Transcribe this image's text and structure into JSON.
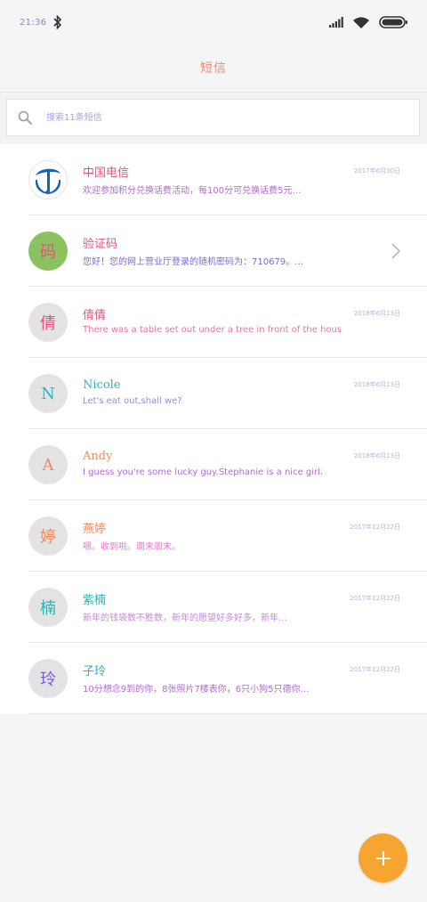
{
  "status_bar": {
    "time": "21:36"
  },
  "header": {
    "title": "短信"
  },
  "search": {
    "placeholder": "搜索11条短信"
  },
  "colors": {
    "fab": "#f6a531",
    "avatar_bg": "#e3e3e3",
    "divider": "#e6e6e6"
  },
  "messages": [
    {
      "avatar": "telecom-logo",
      "avatar_text": "",
      "name": "中国电信",
      "date": "2017年6月30日",
      "preview": "欢迎参加积分兑换话费活动，每100分可兑换话费5元…",
      "name_color": "#e8517f",
      "preview_color": "#b06ad6"
    },
    {
      "avatar": "",
      "avatar_text": "码",
      "name": "验证码",
      "date": "",
      "preview": "您好！您的网上营业厅登录的随机密码为：710679。…",
      "name_color": "#e8517f",
      "preview_color": "#7a6ad6"
    },
    {
      "avatar": "",
      "avatar_text": "倩",
      "name": "倩倩",
      "date": "2018年6月13日",
      "preview": "There was a table set out under a tree in front of the hous",
      "name_color": "#e8517f",
      "preview_color": "#e07a9a"
    },
    {
      "avatar": "",
      "avatar_text": "N",
      "name": "Nicole",
      "date": "2018年6月13日",
      "preview": "Let's eat out,shall we?",
      "name_color": "#28b5c9",
      "preview_color": "#9a8ad6"
    },
    {
      "avatar": "",
      "avatar_text": "A",
      "name": "Andy",
      "date": "2018年6月13日",
      "preview": "I guess you're some lucky guy.Stephanie is a nice girl.",
      "name_color": "#f08a5e",
      "preview_color": "#b36ad6"
    },
    {
      "avatar": "",
      "avatar_text": "婷",
      "name": "燕婷",
      "date": "2017年12月22日",
      "preview": "嗯。收到啦。周末周末。",
      "name_color": "#f08a5e",
      "preview_color": "#e07ad0"
    },
    {
      "avatar": "",
      "avatar_text": "楠",
      "name": "紫楠",
      "date": "2017年12月22日",
      "preview": "新年的钱袋数不胜数，新年的愿望好多好多，新年…",
      "name_color": "#24b5b5",
      "preview_color": "#c48ad6"
    },
    {
      "avatar": "",
      "avatar_text": "玲",
      "name": "子玲",
      "date": "2017年12月22日",
      "preview": "10分想念9到的你，8张照片7楼表你，6只小狗5只德你…",
      "name_color": "#3aa8d8",
      "preview_color": "#b06ad6"
    }
  ]
}
